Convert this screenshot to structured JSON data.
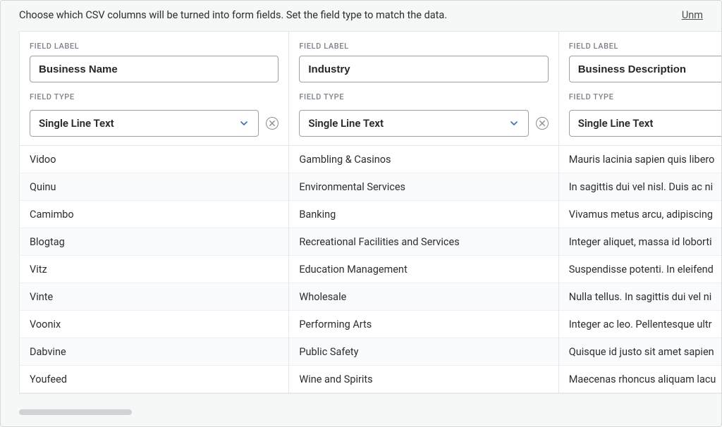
{
  "instructions": "Choose which CSV columns will be turned into form fields. Set the field type to match the data.",
  "unmap_link": "Unm",
  "labels": {
    "field_label": "FIELD LABEL",
    "field_type": "FIELD TYPE"
  },
  "columns": [
    {
      "label_value": "Business Name",
      "type_value": "Single Line Text",
      "show_clear": true,
      "rows": [
        "Vidoo",
        "Quinu",
        "Camimbo",
        "Blogtag",
        "Vitz",
        "Vinte",
        "Voonix",
        "Dabvine",
        "Youfeed"
      ]
    },
    {
      "label_value": "Industry",
      "type_value": "Single Line Text",
      "show_clear": true,
      "rows": [
        "Gambling & Casinos",
        "Environmental Services",
        "Banking",
        "Recreational Facilities and Services",
        "Education Management",
        "Wholesale",
        "Performing Arts",
        "Public Safety",
        "Wine and Spirits"
      ]
    },
    {
      "label_value": "Business Description",
      "type_value": "Single Line Text",
      "show_clear": false,
      "rows": [
        "Mauris lacinia sapien quis libero",
        "In sagittis dui vel nisl. Duis ac ni",
        "Vivamus metus arcu, adipiscing",
        "Integer aliquet, massa id loborti",
        "Suspendisse potenti. In eleifend",
        "Nulla tellus. In sagittis dui vel ni",
        "Integer ac leo. Pellentesque ultr",
        "Quisque id justo sit amet sapien",
        "Maecenas rhoncus aliquam lacu"
      ]
    }
  ]
}
